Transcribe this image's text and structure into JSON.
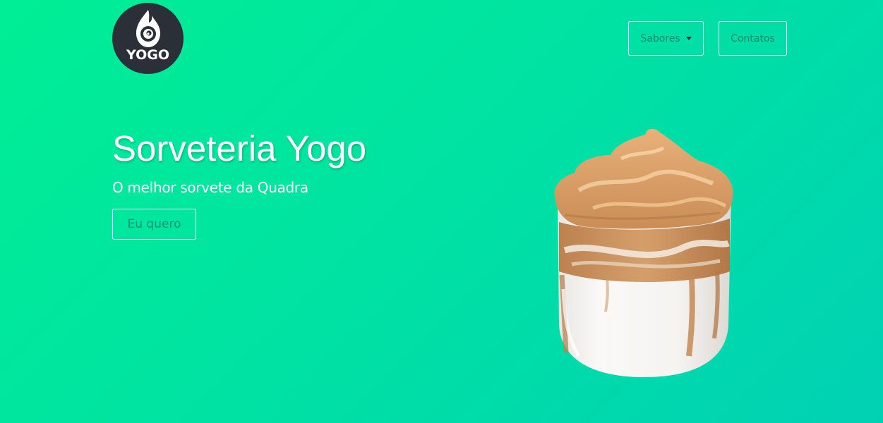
{
  "brand": {
    "logo_text": "YOGO",
    "logo_icon": "swirl-icon",
    "logo_bg": "#2b3038"
  },
  "nav": {
    "items": [
      {
        "label": "Sabores",
        "has_dropdown": true,
        "icon": "caret-down-icon"
      },
      {
        "label": "Contatos",
        "has_dropdown": false
      }
    ]
  },
  "hero": {
    "title": "Sorveteria Yogo",
    "subtitle": "O melhor sorvete da Quadra",
    "cta_label": "Eu quero",
    "image": "iced-coffee-dalgona-glass"
  },
  "colors": {
    "background_start": "#00ee95",
    "background_end": "#00d1b4",
    "button_text": "#14866b",
    "text": "#ffffff"
  }
}
